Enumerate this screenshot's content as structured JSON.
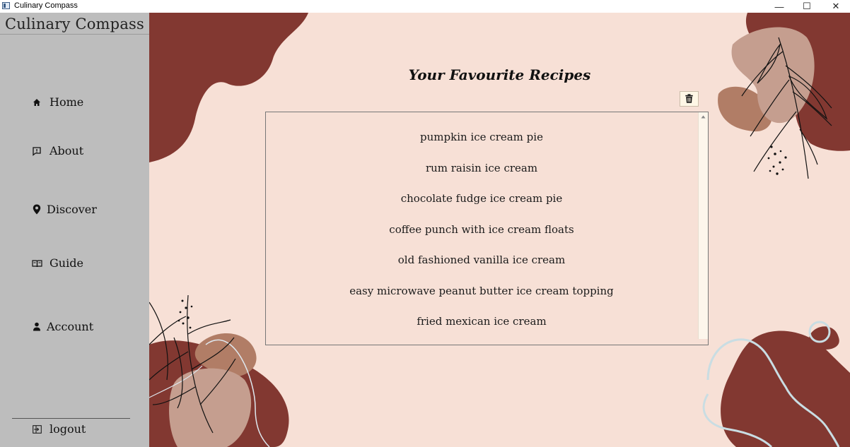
{
  "window": {
    "title": "Culinary Compass",
    "controls": {
      "minimize": "—",
      "maximize": "☐",
      "close": "✕"
    }
  },
  "sidebar": {
    "brand": "Culinary Compass",
    "items": [
      {
        "label": "Home",
        "icon": "home-icon"
      },
      {
        "label": "About",
        "icon": "message-icon"
      },
      {
        "label": "Discover",
        "icon": "map-pin-icon"
      },
      {
        "label": "Guide",
        "icon": "book-icon"
      },
      {
        "label": "Account",
        "icon": "user-icon"
      }
    ],
    "logout": {
      "label": "logout",
      "icon": "logout-icon"
    }
  },
  "main": {
    "heading": "Your Favourite Recipes",
    "delete_icon": "trash-icon",
    "recipes": [
      "pumpkin ice cream pie",
      "rum raisin ice cream",
      "chocolate fudge ice cream pie",
      "coffee punch with ice cream floats",
      "old fashioned vanilla ice cream",
      "easy microwave peanut butter ice cream topping",
      "fried mexican ice cream"
    ]
  },
  "colors": {
    "background": "#f7e0d6",
    "sidebar": "#bdbdbd",
    "accent_dark": "#823831",
    "accent_tan": "#b17d66",
    "accent_light": "#c59e8f",
    "line_blue": "#c9dde3"
  }
}
